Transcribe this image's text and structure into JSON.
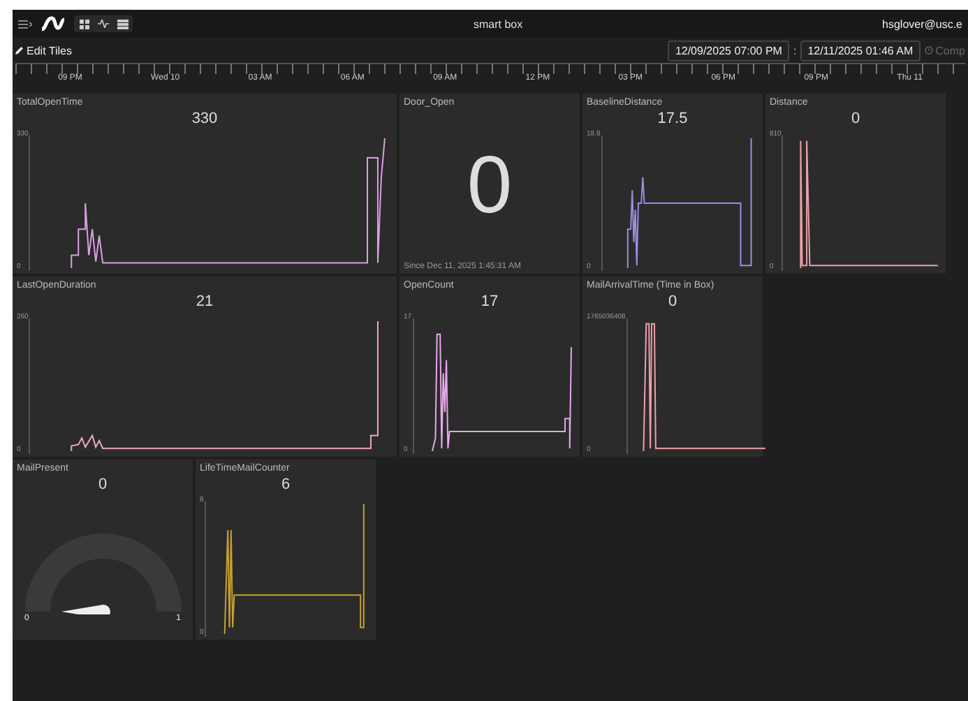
{
  "header": {
    "title": "smart box",
    "user": "hsglover@usc.e"
  },
  "toolbar": {
    "edit_label": "Edit Tiles",
    "start": "12/09/2025 07:00 PM",
    "separator": ":",
    "end": "12/11/2025 01:46 AM",
    "compare": "Comp"
  },
  "timeline": [
    "09 PM",
    "Wed 10",
    "03 AM",
    "06 AM",
    "09 AM",
    "12 PM",
    "03 PM",
    "06 PM",
    "09 PM",
    "Thu 11"
  ],
  "tiles": [
    {
      "kind": "chart",
      "title": "TotalOpenTime",
      "value": "330",
      "y_max": "330",
      "y_min": "0",
      "color": "#d9a0e0"
    },
    {
      "kind": "big",
      "title": "Door_Open",
      "value": "0",
      "subtitle": "Since Dec 11, 2025 1:45:31 AM"
    },
    {
      "kind": "chart",
      "title": "BaselineDistance",
      "value": "17.5",
      "y_max": "18.8",
      "y_min": "0",
      "color": "#9a8ee0"
    },
    {
      "kind": "chart",
      "title": "Distance",
      "value": "0",
      "y_max": "810",
      "y_min": "0",
      "color": "#f0a0a8"
    },
    {
      "kind": "chart",
      "title": "LastOpenDuration",
      "value": "21",
      "y_max": "260",
      "y_min": "0",
      "color": "#f0a8b8"
    },
    {
      "kind": "chart",
      "title": "OpenCount",
      "value": "17",
      "y_max": "17",
      "y_min": "0",
      "color": "#e6a8ec"
    },
    {
      "kind": "chart",
      "title": "MailArrivalTime (Time in Box)",
      "value": "0",
      "y_max": "1765036408",
      "y_min": "0",
      "color": "#f0a0a8"
    },
    {
      "kind": "gauge",
      "title": "MailPresent",
      "value": "0",
      "level": 0,
      "min_label": "0",
      "max_label": "1"
    },
    {
      "kind": "chart",
      "title": "LifeTimeMailCounter",
      "value": "6",
      "y_max": "6",
      "y_min": "0",
      "color": "#c8a030"
    }
  ]
}
